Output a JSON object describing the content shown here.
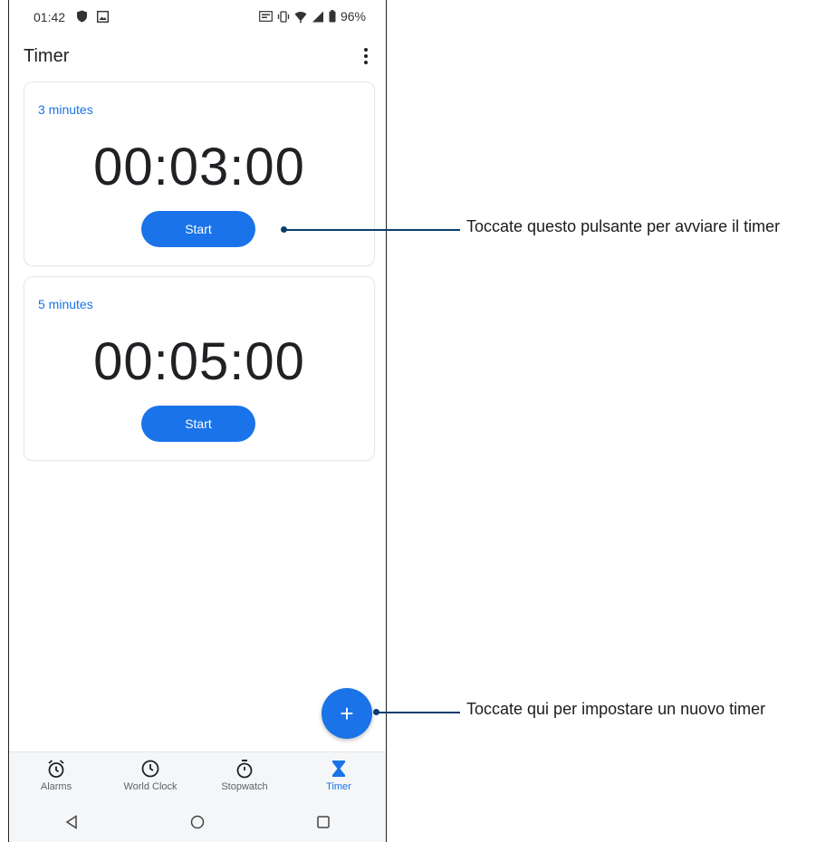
{
  "status_bar": {
    "time": "01:42",
    "battery": "96%"
  },
  "app_bar": {
    "title": "Timer",
    "menu_icon": "more-vert-icon"
  },
  "timers": [
    {
      "label": "3 minutes",
      "time": "00:03:00",
      "button": "Start"
    },
    {
      "label": "5 minutes",
      "time": "00:05:00",
      "button": "Start"
    }
  ],
  "fab": {
    "label": "+"
  },
  "bottom_nav": [
    {
      "label": "Alarms",
      "icon": "alarm-icon",
      "active": false
    },
    {
      "label": "World Clock",
      "icon": "clock-icon",
      "active": false
    },
    {
      "label": "Stopwatch",
      "icon": "stopwatch-icon",
      "active": false
    },
    {
      "label": "Timer",
      "icon": "hourglass-icon",
      "active": true
    }
  ],
  "annotations": {
    "start_hint": "Toccate questo pulsante per avviare il timer",
    "add_hint": "Toccate qui per impostare un nuovo timer"
  },
  "colors": {
    "accent": "#1a73e8",
    "callout": "#0b3d6e"
  }
}
